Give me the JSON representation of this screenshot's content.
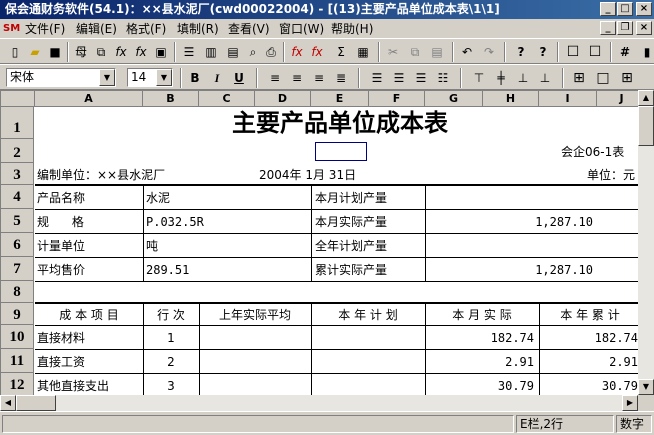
{
  "window": {
    "title": "保会通财务软件(54.1)：××县水泥厂(cwd00022004) - [(13)主要产品单位成本表\\1\\1]"
  },
  "menu": {
    "items": [
      "文件(F)",
      "编辑(E)",
      "格式(F)",
      "填制(R)",
      "查看(V)",
      "窗口(W)",
      "帮助(H)"
    ]
  },
  "toolbar": {
    "font_name": "宋体",
    "font_size": "14"
  },
  "grid": {
    "columns": [
      "A",
      "B",
      "C",
      "D",
      "E",
      "F",
      "G",
      "H",
      "I",
      "J"
    ],
    "rows": [
      "1",
      "2",
      "3",
      "4",
      "5",
      "6",
      "7",
      "8",
      "9",
      "10",
      "11",
      "12"
    ]
  },
  "report": {
    "title": "主要产品单位成本表",
    "form_code": "会企06-1表",
    "unit_label": "编制单位：××县水泥厂",
    "date": "2004年  1月  31日",
    "currency_label": "单位：元",
    "info": {
      "product_name_label": "产品名称",
      "product_name": "水泥",
      "spec_label": "规      格",
      "spec": "P.032.5R",
      "unit_measure_label": "计量单位",
      "unit_measure": "吨",
      "avg_price_label": "平均售价",
      "avg_price": "289.51",
      "plan_qty_label": "本月计划产量",
      "actual_qty_label": "本月实际产量",
      "actual_qty": "1,287.10",
      "year_plan_label": "全年计划产量",
      "cum_actual_label": "累计实际产量",
      "cum_actual": "1,287.10"
    },
    "table_headers": [
      "成 本 项 目",
      "行 次",
      "上年实际平均",
      "本 年 计 划",
      "本 月 实 际",
      "本 年 累 计"
    ],
    "table_rows": [
      {
        "item": "直接材料",
        "line": "1",
        "month": "182.74",
        "cum": "182.74"
      },
      {
        "item": "直接工资",
        "line": "2",
        "month": "2.91",
        "cum": "2.91"
      },
      {
        "item": "其他直接支出",
        "line": "3",
        "month": "30.79",
        "cum": "30.79"
      }
    ]
  },
  "status": {
    "position": "E栏,2行",
    "mode": "数字"
  }
}
